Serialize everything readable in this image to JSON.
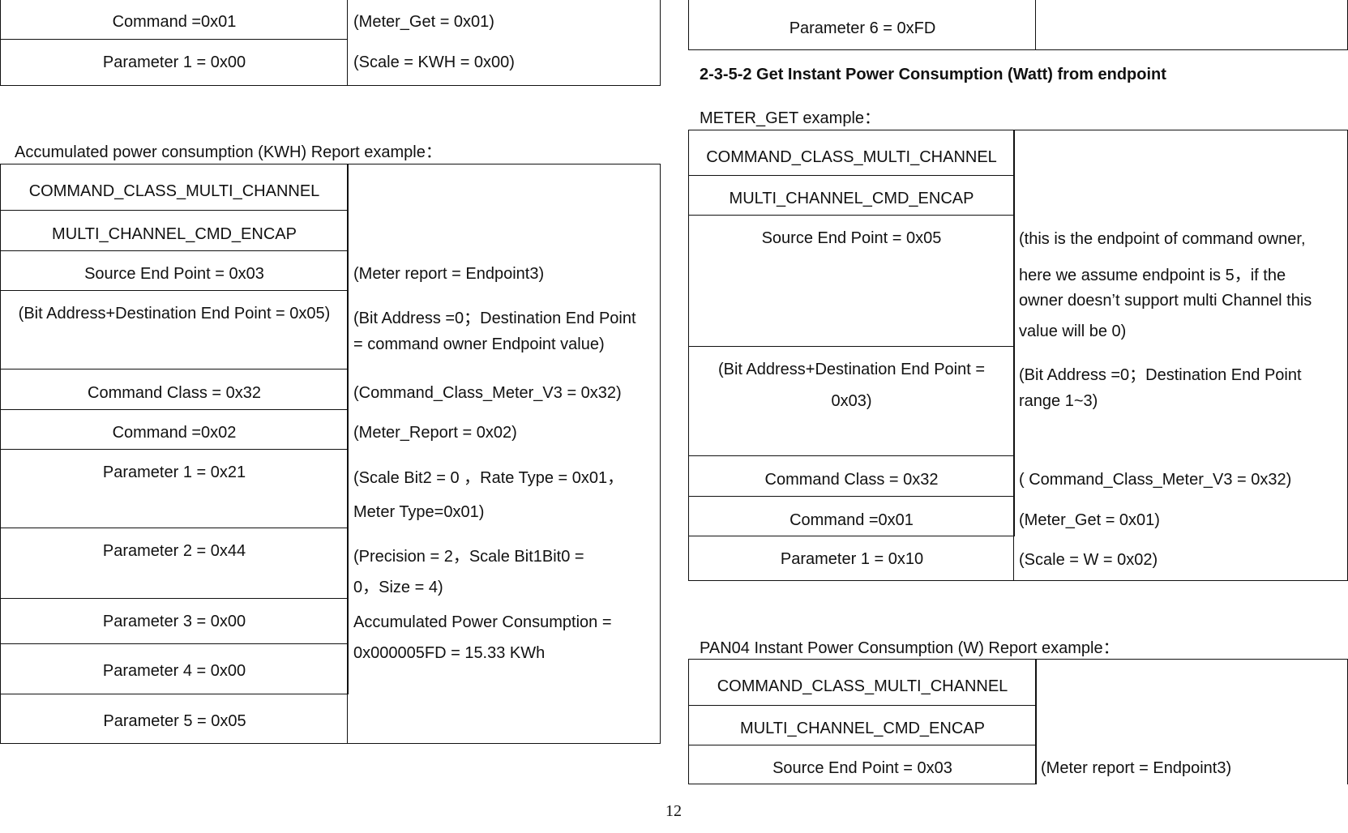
{
  "page_number": "12",
  "left": {
    "table_top": {
      "rows": [
        {
          "field": "Command =0x01",
          "note": "(Meter_Get = 0x01)"
        },
        {
          "field": "Parameter 1 = 0x00",
          "note": "(Scale = KWH = 0x00)"
        }
      ]
    },
    "kwh_report_label": "Accumulated power consumption (KWH) Report example：",
    "kwh_report_table": {
      "rows": [
        {
          "field": "COMMAND_CLASS_MULTI_CHANNEL"
        },
        {
          "field": "MULTI_CHANNEL_CMD_ENCAP"
        },
        {
          "field": "Source End Point = 0x03"
        },
        {
          "field": "(Bit Address+Destination End Point = 0x05)"
        },
        {
          "field": "Command Class = 0x32"
        },
        {
          "field": "Command =0x02"
        },
        {
          "field": "Parameter 1 = 0x21"
        },
        {
          "field": "Parameter 2 = 0x44"
        },
        {
          "field": "Parameter 3 = 0x00"
        },
        {
          "field": "Parameter 4 = 0x00"
        },
        {
          "field": "Parameter 5 = 0x05"
        }
      ],
      "notes": [
        "(Meter report = Endpoint3)",
        "(Bit Address =0；Destination End Point",
        "= command owner Endpoint value)",
        "(Command_Class_Meter_V3 = 0x32)",
        "(Meter_Report = 0x02)",
        "(Scale Bit2 = 0 ，Rate Type = 0x01，",
        "Meter Type=0x01)",
        "(Precision = 2，Scale Bit1Bit0 =",
        "0，Size = 4)",
        "Accumulated Power Consumption =",
        "0x000005FD = 15.33 KWh"
      ]
    }
  },
  "right": {
    "table_top": {
      "rows": [
        {
          "field": "Parameter 6 = 0xFD",
          "note": ""
        }
      ]
    },
    "section_heading": "2-3-5-2 Get Instant Power Consumption (Watt) from endpoint",
    "meter_get_label": "METER_GET example：",
    "meter_get_table": {
      "rows": [
        {
          "field": "COMMAND_CLASS_MULTI_CHANNEL"
        },
        {
          "field": "MULTI_CHANNEL_CMD_ENCAP"
        },
        {
          "field": "Source End Point = 0x05"
        },
        {
          "field": "(Bit Address+Destination End Point =",
          "field2": "0x03)"
        },
        {
          "field": "Command Class = 0x32"
        },
        {
          "field": "Command =0x01"
        },
        {
          "field": "Parameter 1 = 0x10"
        }
      ],
      "notes": [
        "(this is the endpoint of command owner,",
        "here we assume endpoint is 5，if the",
        "owner doesn’t support multi Channel this",
        "value will be 0)",
        "(Bit Address =0；Destination End Point",
        "range 1~3)",
        "( Command_Class_Meter_V3 = 0x32)",
        "(Meter_Get = 0x01)",
        "(Scale = W = 0x02)"
      ]
    },
    "w_report_label": "PAN04 Instant Power Consumption (W) Report example：",
    "w_report_table": {
      "rows": [
        {
          "field": "COMMAND_CLASS_MULTI_CHANNEL"
        },
        {
          "field": "MULTI_CHANNEL_CMD_ENCAP"
        },
        {
          "field": "Source End Point = 0x03"
        }
      ],
      "notes": [
        "(Meter report = Endpoint3)"
      ]
    }
  }
}
